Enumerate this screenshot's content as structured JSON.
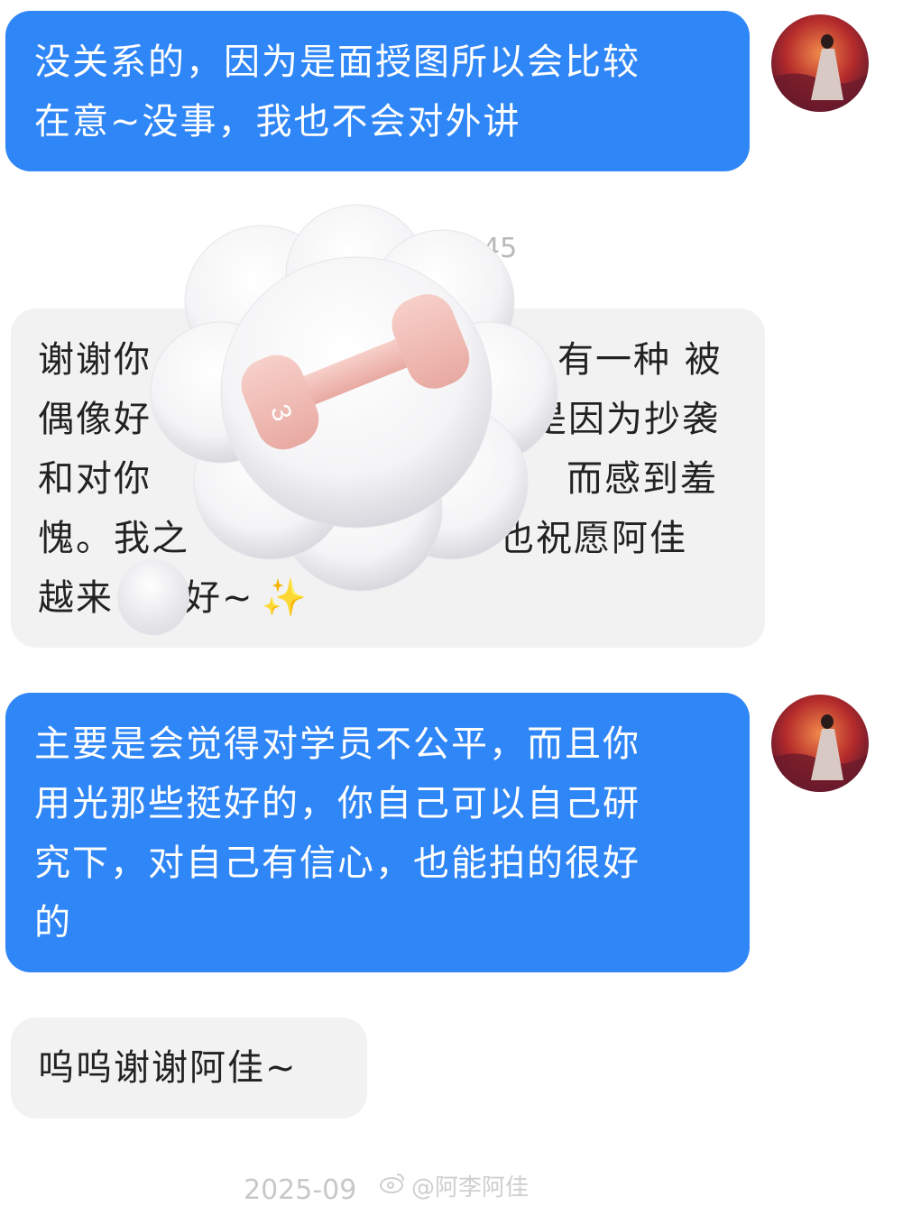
{
  "messages": {
    "m1": {
      "text": "没关系的，因为是面授图所以会比较\n在意~没事，我也不会对外讲"
    },
    "time1": {
      "text": "45"
    },
    "m2": {
      "lines": [
        "谢谢你",
        "有一种 被",
        "偶像好",
        "是因为抄袭",
        "和对你",
        "而感到羞",
        "愧。我之",
        "也祝愿阿佳",
        "越来",
        "好~",
        "✨"
      ]
    },
    "m3": {
      "text": "主要是会觉得对学员不公平，而且你\n用光那些挺好的，你自己可以自己研\n究下，对自己有信心，也能拍的很好\n的"
    },
    "m4": {
      "text": "呜呜谢谢阿佳~"
    },
    "time2": {
      "text": "2025-09"
    }
  },
  "watermark": {
    "text": "@阿李阿佳"
  },
  "sticker": {
    "icon": "cloud-dumbbell-sticker",
    "dumbbell_label": "3"
  },
  "colors": {
    "outgoing_bubble": "#2f86f6",
    "incoming_bubble": "#f2f2f2",
    "outgoing_text": "#ffffff",
    "incoming_text": "#222222"
  }
}
